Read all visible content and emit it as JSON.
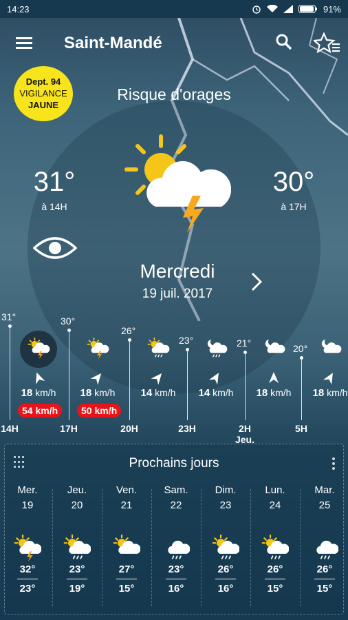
{
  "status": {
    "time": "14:23",
    "battery": "91%"
  },
  "header": {
    "city": "Saint-Mandé"
  },
  "vigilance": {
    "line1": "Dept. 94",
    "line2": "VIGILANCE",
    "line3": "JAUNE",
    "color": "#f8e41a"
  },
  "current": {
    "condition": "Risque d'orages",
    "temp_left": "31°",
    "time_left": "à 14H",
    "temp_right": "30°",
    "time_right": "à 17H",
    "icon": "sun-cloud-lightning-icon",
    "day": "Mercredi",
    "date": "19 juil. 2017"
  },
  "hourly": [
    {
      "temp": "31°",
      "wind": "18",
      "unit": "km/h",
      "gust": "54 km/h",
      "label": "14H",
      "sub": "",
      "icon": "sun-cloud-lightning"
    },
    {
      "temp": "30°",
      "wind": "18",
      "unit": "km/h",
      "gust": "50 km/h",
      "label": "17H",
      "sub": "",
      "icon": "sun-cloud-lightning"
    },
    {
      "temp": "26°",
      "wind": "14",
      "unit": "km/h",
      "gust": "",
      "label": "20H",
      "sub": "",
      "icon": "sun-cloud-rain"
    },
    {
      "temp": "23°",
      "wind": "14",
      "unit": "km/h",
      "gust": "",
      "label": "23H",
      "sub": "",
      "icon": "moon-cloud-rain"
    },
    {
      "temp": "21°",
      "wind": "18",
      "unit": "km/h",
      "gust": "",
      "label": "2H",
      "sub": "Jeu.",
      "icon": "moon-cloud"
    },
    {
      "temp": "20°",
      "wind": "18",
      "unit": "km/h",
      "gust": "",
      "label": "5H",
      "sub": "",
      "icon": "moon-cloud"
    }
  ],
  "daily_title": "Prochains jours",
  "daily": [
    {
      "name": "Mer.",
      "num": "19",
      "max": "32°",
      "min": "23°",
      "icon": "sun-cloud-lightning"
    },
    {
      "name": "Jeu.",
      "num": "20",
      "max": "23°",
      "min": "19°",
      "icon": "sun-cloud-rain"
    },
    {
      "name": "Ven.",
      "num": "21",
      "max": "27°",
      "min": "15°",
      "icon": "sun-cloud"
    },
    {
      "name": "Sam.",
      "num": "22",
      "max": "23°",
      "min": "16°",
      "icon": "cloud-rain"
    },
    {
      "name": "Dim.",
      "num": "23",
      "max": "26°",
      "min": "16°",
      "icon": "sun-cloud-rain"
    },
    {
      "name": "Lun.",
      "num": "24",
      "max": "26°",
      "min": "15°",
      "icon": "sun-cloud-rain"
    },
    {
      "name": "Mar.",
      "num": "25",
      "max": "26°",
      "min": "15°",
      "icon": "cloud-rain"
    }
  ],
  "colors": {
    "gust_badge": "#e8141a",
    "sun": "#f5c518",
    "bolt": "#f7a81c"
  }
}
